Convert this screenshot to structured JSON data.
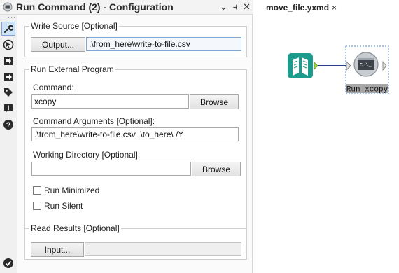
{
  "header": {
    "title": "Run Command (2) - Configuration",
    "controls": [
      "⌄",
      "⫞",
      "✕"
    ]
  },
  "canvas": {
    "tab_label": "move_file.yxmd",
    "tab_close": "×",
    "tool_label": "Run xcopy",
    "tool_icon_text": "C:\\_"
  },
  "write_source": {
    "legend": "Write Source [Optional]",
    "output_button": "Output...",
    "output_value": ".\\from_here\\write-to-file.csv"
  },
  "external_program": {
    "legend": "Run External Program",
    "command_label": "Command:",
    "command_value": "xcopy",
    "browse_label": "Browse",
    "args_label": "Command Arguments [Optional]:",
    "args_value": ".\\from_here\\write-to-file.csv .\\to_here\\ /Y",
    "workdir_label": "Working Directory [Optional]:",
    "workdir_value": "",
    "workdir_browse": "Browse",
    "run_minimized": "Run Minimized",
    "run_silent": "Run Silent"
  },
  "read_results": {
    "legend": "Read Results [Optional]",
    "input_button": "Input...",
    "input_value": ""
  },
  "colors": {
    "accent": "#1c9c8c",
    "selection": "#cfe3f7",
    "connection": "#2b3a8c"
  }
}
